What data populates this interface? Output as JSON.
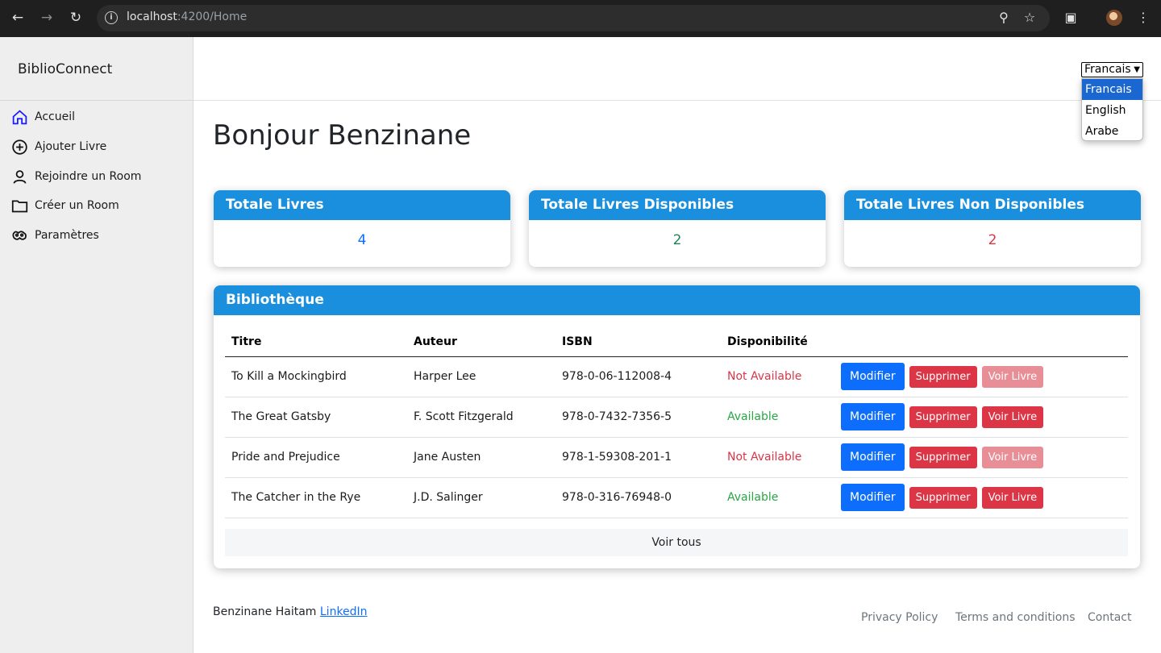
{
  "browser": {
    "url_host": "localhost",
    "url_rest": ":4200/Home"
  },
  "sidebar": {
    "brand": "BiblioConnect",
    "items": [
      {
        "label": "Accueil",
        "icon": "home-icon"
      },
      {
        "label": "Ajouter Livre",
        "icon": "plus-circle-icon"
      },
      {
        "label": "Rejoindre un Room",
        "icon": "user-icon"
      },
      {
        "label": "Créer un Room",
        "icon": "folder-icon"
      },
      {
        "label": "Paramètres",
        "icon": "settings-icon"
      }
    ]
  },
  "language": {
    "selected": "Francais",
    "options": [
      "Francais",
      "English",
      "Arabe"
    ]
  },
  "greeting": "Bonjour Benzinane",
  "stats": [
    {
      "title": "Totale Livres",
      "value": "4",
      "color": "#0d6efd"
    },
    {
      "title": "Totale Livres Disponibles",
      "value": "2",
      "color": "#198754"
    },
    {
      "title": "Totale Livres Non Disponibles",
      "value": "2",
      "color": "#dc3545"
    }
  ],
  "library": {
    "title": "Bibliothèque",
    "columns": [
      "Titre",
      "Auteur",
      "ISBN",
      "Disponibilité"
    ],
    "rows": [
      {
        "title": "To Kill a Mockingbird",
        "author": "Harper Lee",
        "isbn": "978-0-06-112008-4",
        "status": "Not Available"
      },
      {
        "title": "The Great Gatsby",
        "author": "F. Scott Fitzgerald",
        "isbn": "978-0-7432-7356-5",
        "status": "Available"
      },
      {
        "title": "Pride and Prejudice",
        "author": "Jane Austen",
        "isbn": "978-1-59308-201-1",
        "status": "Not Available"
      },
      {
        "title": "The Catcher in the Rye",
        "author": "J.D. Salinger",
        "isbn": "978-0-316-76948-0",
        "status": "Available"
      }
    ],
    "actions": {
      "edit": "Modifier",
      "delete": "Supprimer",
      "view": "Voir Livre"
    },
    "view_all": "Voir tous"
  },
  "footer": {
    "author": "Benzinane Haitam",
    "linkedin": "LinkedIn",
    "links": [
      "Privacy Policy",
      "Terms and conditions",
      "Contact"
    ]
  }
}
